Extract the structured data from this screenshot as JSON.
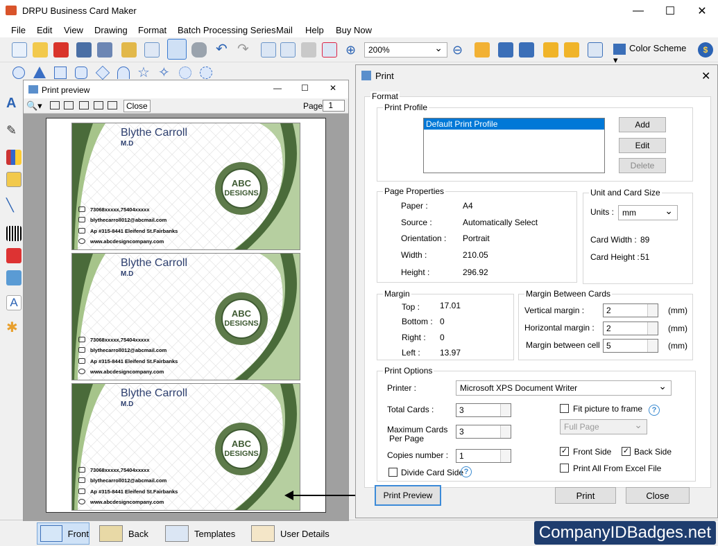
{
  "app": {
    "title": "DRPU Business Card Maker"
  },
  "menu": [
    "File",
    "Edit",
    "View",
    "Drawing",
    "Format",
    "Batch Processing Series",
    "Mail",
    "Help",
    "Buy Now"
  ],
  "toolbar": {
    "zoom": "200%",
    "color_scheme": "Color Scheme"
  },
  "preview": {
    "title": "Print preview",
    "close": "Close",
    "page_label": "Page",
    "page_value": "1"
  },
  "card": {
    "name": "Blythe Carroll",
    "title": "M.D",
    "phone": "73068xxxxx,75404xxxxx",
    "email": "blythecarroll012@abcmail.com",
    "address": "Ap #315-8441 Eleifend St.Fairbanks",
    "web": "www.abcdesigncompany.com",
    "logo1": "ABC",
    "logo2": "DESIGNS"
  },
  "dialog": {
    "title": "Print",
    "format": "Format",
    "print_profile": "Print Profile",
    "profile_item": "Default Print Profile",
    "add": "Add",
    "edit": "Edit",
    "delete": "Delete",
    "page_properties": "Page Properties",
    "paper_l": "Paper :",
    "paper_v": "A4",
    "source_l": "Source :",
    "source_v": "Automatically Select",
    "orient_l": "Orientation :",
    "orient_v": "Portrait",
    "width_l": "Width :",
    "width_v": "210.05",
    "height_l": "Height :",
    "height_v": "296.92",
    "unit_card": "Unit and Card Size",
    "units_l": "Units :",
    "units_v": "mm",
    "cw_l": "Card Width :",
    "cw_v": "89",
    "ch_l": "Card Height :",
    "ch_v": "51",
    "margin": "Margin",
    "top_l": "Top :",
    "top_v": "17.01",
    "bottom_l": "Bottom :",
    "bottom_v": "0",
    "right_l": "Right :",
    "right_v": "0",
    "left_l": "Left :",
    "left_v": "13.97",
    "mbc": "Margin Between Cards",
    "vm_l": "Vertical margin :",
    "vm_v": "2",
    "hm_l": "Horizontal margin :",
    "hm_v": "2",
    "mbcell_l": "Margin between cell :",
    "mbcell_v": "5",
    "mm": "(mm)",
    "print_options": "Print Options",
    "printer_l": "Printer :",
    "printer_v": "Microsoft XPS Document Writer",
    "total_l": "Total Cards :",
    "total_v": "3",
    "max_l1": "Maximum Cards",
    "max_l2": "Per Page",
    "max_v": "3",
    "copies_l": "Copies number :",
    "copies_v": "1",
    "divide": "Divide Card Side",
    "fit": "Fit picture to frame",
    "fullpage": "Full Page",
    "front": "Front Side",
    "back": "Back Side",
    "excel": "Print All From Excel File",
    "preview_btn": "Print Preview",
    "print_btn": "Print",
    "close_btn": "Close"
  },
  "bottom_tabs": [
    "Front",
    "Back",
    "Templates",
    "User Details"
  ],
  "brand": "CompanyIDBadges.net"
}
